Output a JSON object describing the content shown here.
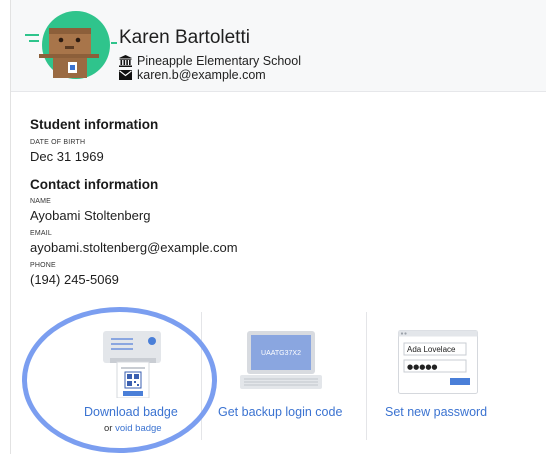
{
  "user": {
    "name": "Karen Bartoletti",
    "school": "Pineapple Elementary School",
    "email": "karen.b@example.com"
  },
  "student_info": {
    "title": "Student information",
    "dob_label": "DATE OF BIRTH",
    "dob_value": "Dec 31 1969"
  },
  "contact_info": {
    "title": "Contact information",
    "name_label": "NAME",
    "name_value": "Ayobami Stoltenberg",
    "email_label": "EMAIL",
    "email_value": "ayobami.stoltenberg@example.com",
    "phone_label": "PHONE",
    "phone_value": "(194) 245-5069"
  },
  "actions": {
    "download_badge": "Download badge",
    "or_text": "or",
    "void_badge": "void badge",
    "backup_code": "Get backup login code",
    "laptop_code": "UAATG37X2",
    "set_password": "Set new password",
    "password_sample_name": "Ada Lovelace",
    "password_dots": "●●●●●"
  },
  "colors": {
    "link": "#3b73d1",
    "highlight": "#7b9ef0",
    "avatar_bg": "#2fc48c"
  }
}
